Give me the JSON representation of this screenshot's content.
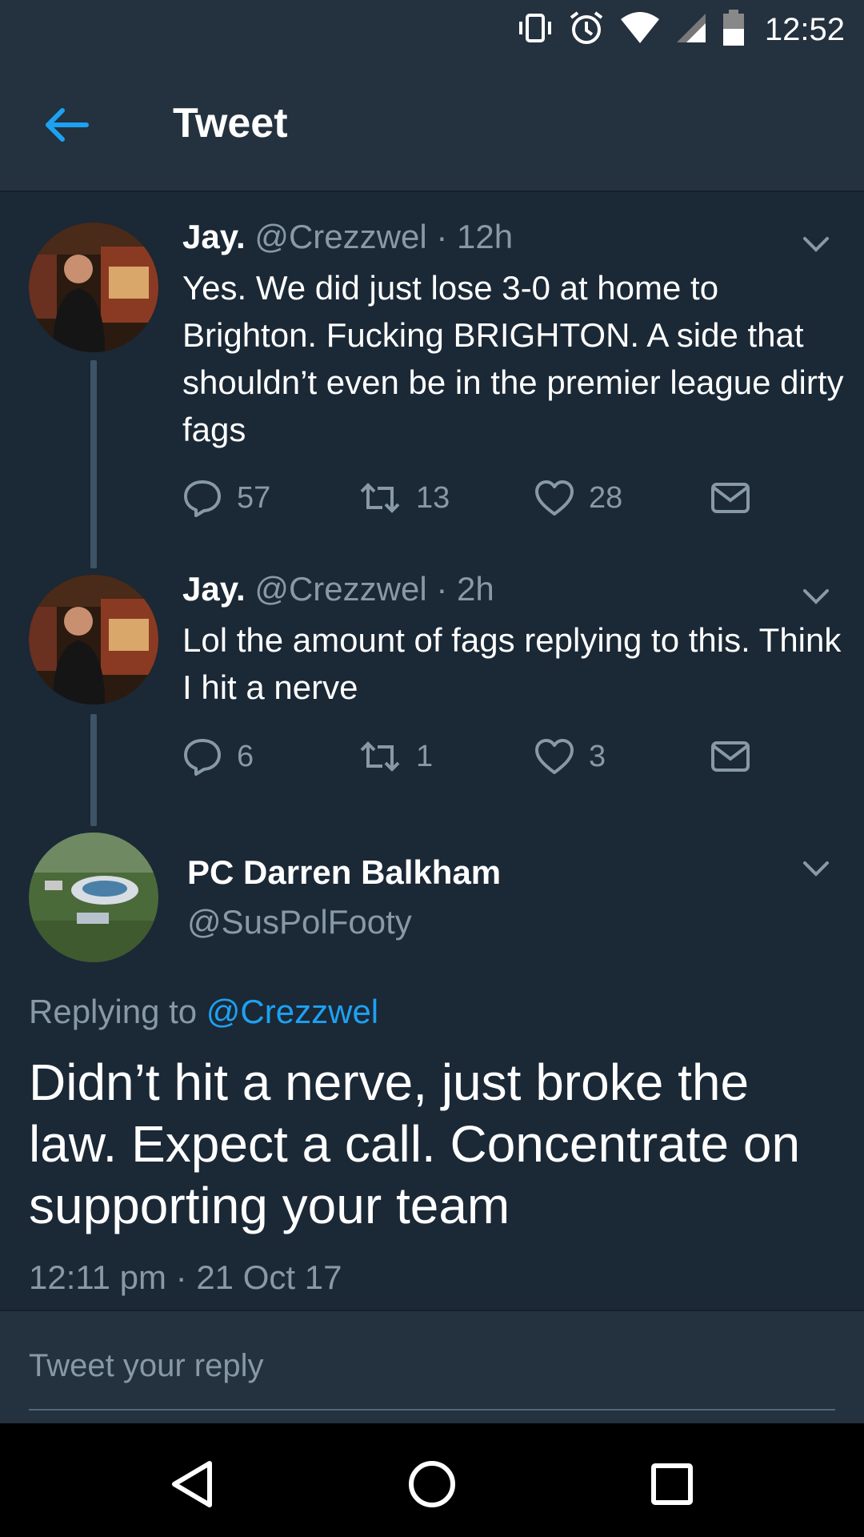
{
  "status_bar": {
    "time": "12:52",
    "icons": [
      "vibrate-icon",
      "alarm-icon",
      "wifi-icon",
      "signal-icon",
      "battery-icon"
    ]
  },
  "app_bar": {
    "title": "Tweet",
    "back_icon": "back-arrow-icon"
  },
  "thread": [
    {
      "name": "Jay.",
      "handle": "@Crezzwel",
      "time": "· 12h",
      "text": "Yes. We did just lose 3-0 at home to Brighton. Fucking BRIGHTON. A side that shouldn’t even be in the premier league dirty fags",
      "replies": "57",
      "retweets": "13",
      "likes": "28"
    },
    {
      "name": "Jay.",
      "handle": "@Crezzwel",
      "time": "· 2h",
      "text": "Lol the amount of fags replying to this. Think I hit a nerve",
      "replies": "6",
      "retweets": "1",
      "likes": "3"
    }
  ],
  "main_tweet": {
    "name": "PC Darren Balkham",
    "handle": "@SusPolFooty",
    "replying_label": "Replying to",
    "replying_to": "@Crezzwel",
    "text": "Didn’t hit a nerve, just broke the law. Expect a call. Concentrate on supporting your team",
    "timestamp": "12:11 pm · 21 Oct 17"
  },
  "reply_box": {
    "placeholder": "Tweet your reply"
  },
  "colors": {
    "background": "#1b2836",
    "bar": "#24313f",
    "accent": "#1da1f2",
    "muted": "#8899a6"
  }
}
